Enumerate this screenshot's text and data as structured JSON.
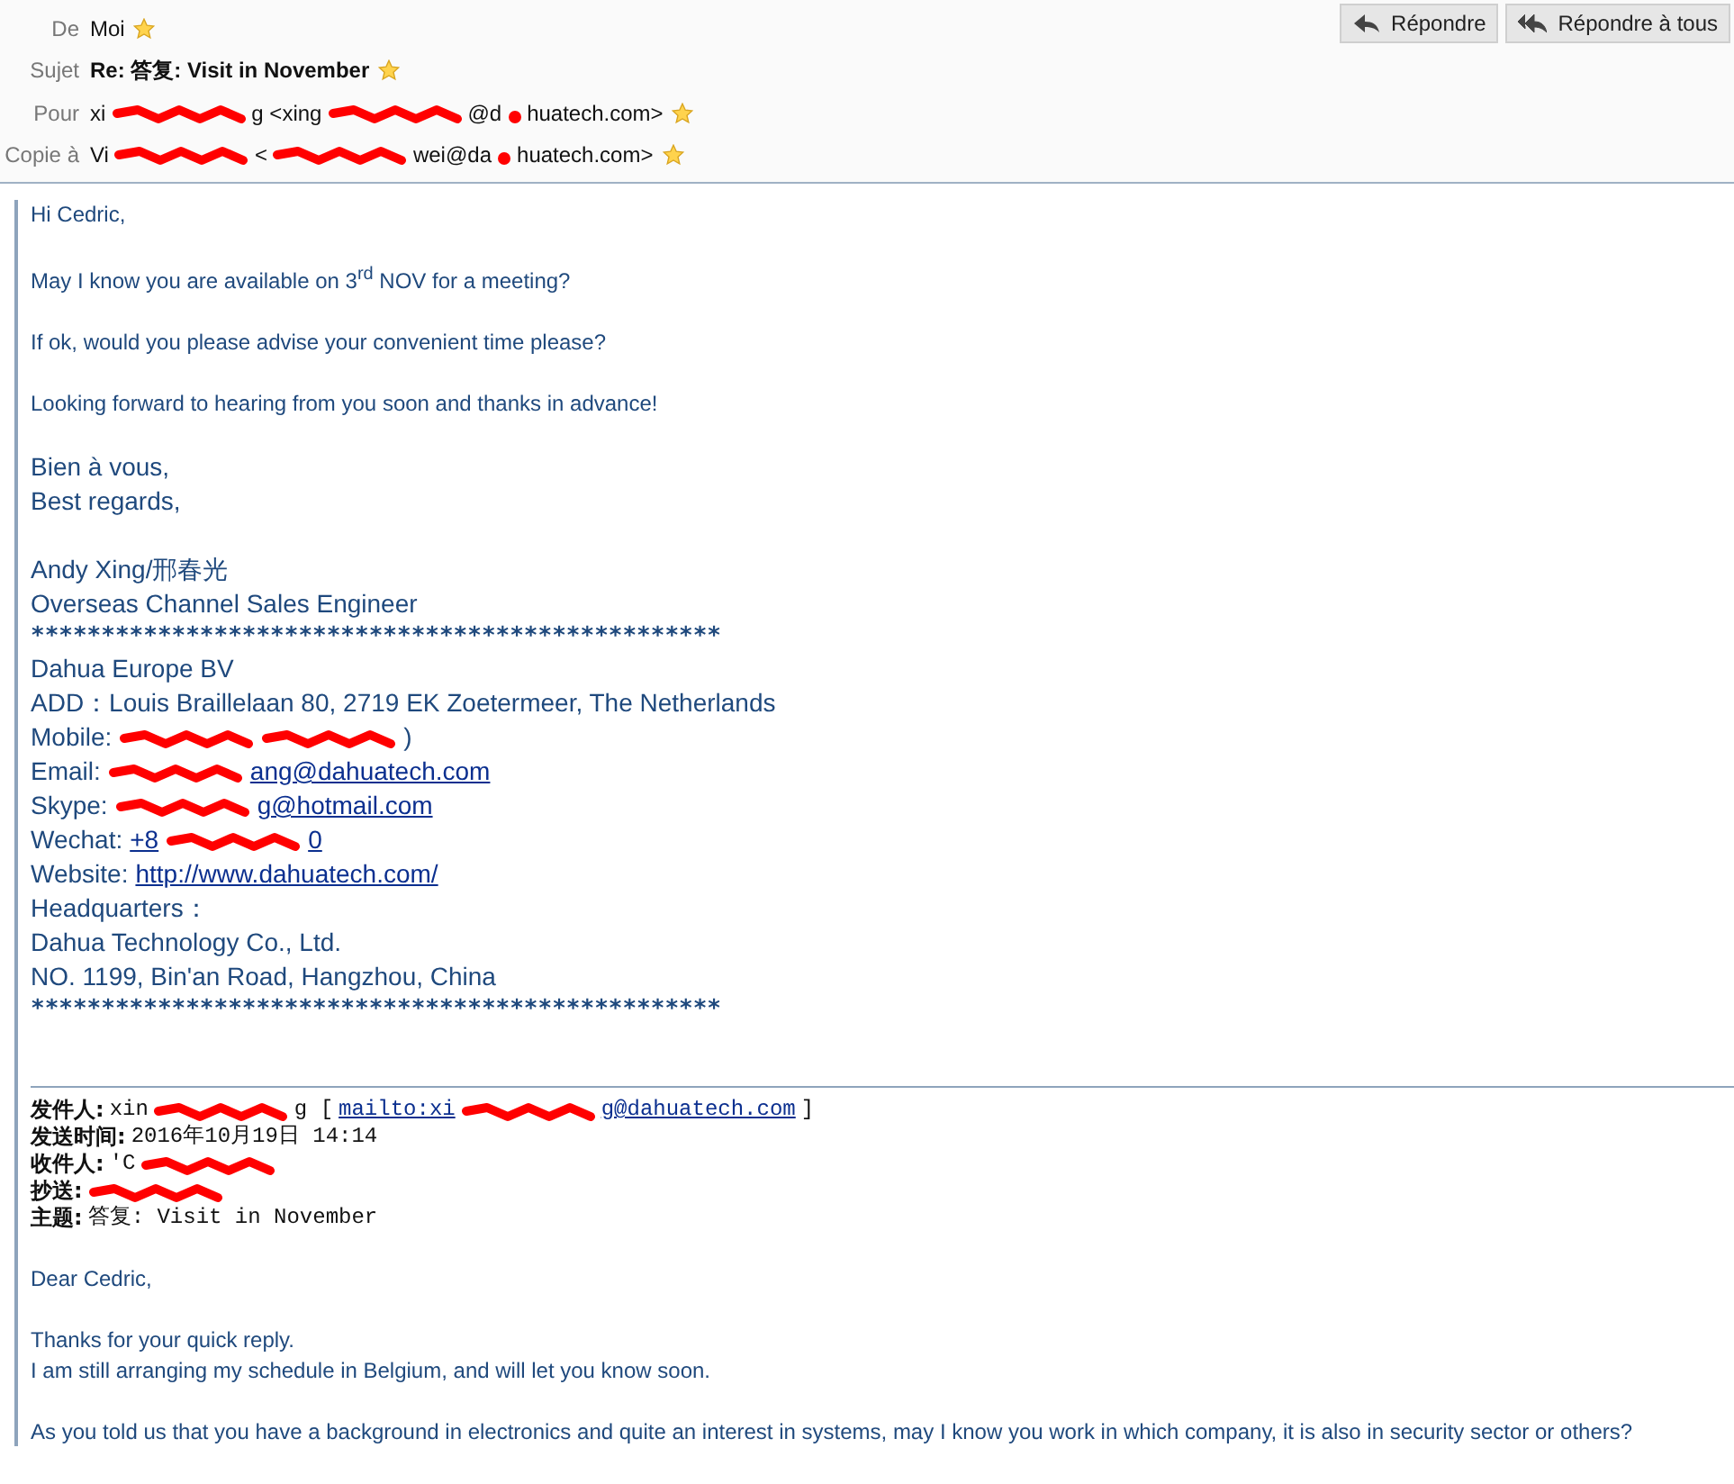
{
  "header": {
    "fields": [
      {
        "label": "De",
        "bold": false,
        "parts": [
          {
            "kind": "text",
            "text": "Moi"
          }
        ]
      },
      {
        "label": "Sujet",
        "bold": true,
        "parts": [
          {
            "kind": "text",
            "text": "Re: 答复: Visit in November"
          }
        ]
      },
      {
        "label": "Pour",
        "bold": false,
        "parts": [
          {
            "kind": "text",
            "text": "xi"
          },
          {
            "kind": "redaction"
          },
          {
            "kind": "text",
            "text": "g <xing"
          },
          {
            "kind": "redaction"
          },
          {
            "kind": "text",
            "text": "@d"
          },
          {
            "kind": "redaction-dot"
          },
          {
            "kind": "text",
            "text": "huatech.com>"
          }
        ]
      },
      {
        "label": "Copie à",
        "bold": false,
        "parts": [
          {
            "kind": "text",
            "text": "Vi"
          },
          {
            "kind": "redaction"
          },
          {
            "kind": "text",
            "text": "<"
          },
          {
            "kind": "redaction"
          },
          {
            "kind": "text",
            "text": "wei@da"
          },
          {
            "kind": "redaction-dot"
          },
          {
            "kind": "text",
            "text": "huatech.com>"
          }
        ]
      }
    ],
    "buttons": [
      "Répondre",
      "Répondre à tous"
    ]
  },
  "body": [
    {
      "kind": "small",
      "parts": [
        {
          "kind": "text",
          "text": "Hi Cedric,"
        }
      ]
    },
    {
      "kind": "small",
      "parts": [
        {
          "kind": "text",
          "text": "May I know you are available on 3$^{rd}$ NOV for a meeting?"
        }
      ]
    },
    {
      "kind": "small",
      "parts": [
        {
          "kind": "text",
          "text": "If ok, would you please advise your convenient time please?"
        }
      ]
    },
    {
      "kind": "small",
      "parts": [
        {
          "kind": "text",
          "text": "Looking forward to hearing from you soon and thanks in advance!"
        }
      ]
    },
    {
      "kind": "large",
      "parts": [
        {
          "kind": "text",
          "text": "Bien à vous,"
        }
      ]
    },
    {
      "kind": "large",
      "parts": [
        {
          "kind": "text",
          "text": "Best regards,"
        }
      ]
    },
    {
      "kind": "blank"
    },
    {
      "kind": "large",
      "parts": [
        {
          "kind": "text",
          "text": "Andy Xing/邢春光"
        }
      ]
    },
    {
      "kind": "large",
      "parts": [
        {
          "kind": "text",
          "text": "Overseas Channel Sales Engineer"
        }
      ]
    },
    {
      "kind": "stars",
      "text": "*************************************************"
    },
    {
      "kind": "large",
      "parts": [
        {
          "kind": "text",
          "text": "Dahua Europe BV"
        }
      ]
    },
    {
      "kind": "large",
      "parts": [
        {
          "kind": "text",
          "text": "ADD：Louis Braillelaan 80, 2719 EK Zoetermeer, The Netherlands"
        }
      ]
    },
    {
      "kind": "large",
      "parts": [
        {
          "kind": "text",
          "text": "Mobile:"
        },
        {
          "kind": "redaction"
        },
        {
          "kind": "redaction"
        },
        {
          "kind": "text",
          "text": ")"
        }
      ]
    },
    {
      "kind": "large",
      "parts": [
        {
          "kind": "text",
          "text": "Email:"
        },
        {
          "kind": "redaction"
        },
        {
          "kind": "link",
          "text": "ang@dahuatech.com"
        }
      ]
    },
    {
      "kind": "large",
      "parts": [
        {
          "kind": "text",
          "text": "Skype:"
        },
        {
          "kind": "redaction"
        },
        {
          "kind": "link",
          "text": "g@hotmail.com"
        }
      ]
    },
    {
      "kind": "large",
      "parts": [
        {
          "kind": "text",
          "text": "Wechat:"
        },
        {
          "kind": "link",
          "text": "+8"
        },
        {
          "kind": "redaction"
        },
        {
          "kind": "link",
          "text": "0"
        }
      ]
    },
    {
      "kind": "large",
      "parts": [
        {
          "kind": "text",
          "text": "Website:"
        },
        {
          "kind": "link",
          "text": "http://www.dahuatech.com/"
        }
      ]
    },
    {
      "kind": "large",
      "parts": [
        {
          "kind": "text",
          "text": "Headquarters："
        }
      ]
    },
    {
      "kind": "large",
      "parts": [
        {
          "kind": "text",
          "text": "Dahua Technology Co., Ltd."
        }
      ]
    },
    {
      "kind": "large",
      "parts": [
        {
          "kind": "text",
          "text": "NO. 1199, Bin'an Road, Hangzhou, China"
        }
      ]
    },
    {
      "kind": "stars",
      "text": "*************************************************"
    }
  ],
  "quoted": {
    "headers": [
      {
        "parts": [
          {
            "kind": "label",
            "text": "发件人:"
          },
          {
            "kind": "text",
            "text": "xin"
          },
          {
            "kind": "redaction"
          },
          {
            "kind": "text",
            "text": "g ["
          },
          {
            "kind": "link",
            "text": "mailto:xi"
          },
          {
            "kind": "redaction"
          },
          {
            "kind": "link",
            "text": "g@dahuatech.com"
          },
          {
            "kind": "text",
            "text": "]"
          }
        ]
      },
      {
        "parts": [
          {
            "kind": "label",
            "text": "发送时间:"
          },
          {
            "kind": "text",
            "text": "2016年10月19日 14:14"
          }
        ]
      },
      {
        "parts": [
          {
            "kind": "label",
            "text": "收件人:"
          },
          {
            "kind": "text",
            "text": "'C"
          },
          {
            "kind": "redaction"
          }
        ]
      },
      {
        "parts": [
          {
            "kind": "label",
            "text": "抄送:"
          },
          {
            "kind": "redaction"
          }
        ]
      },
      {
        "parts": [
          {
            "kind": "label",
            "text": "主题:"
          },
          {
            "kind": "text",
            "text": "答复: Visit in November"
          }
        ]
      }
    ],
    "body": [
      {
        "kind": "small",
        "parts": [
          {
            "kind": "text",
            "text": "Dear Cedric,"
          }
        ]
      },
      {
        "kind": "tight",
        "parts": [
          {
            "kind": "text",
            "text": "Thanks for your quick reply."
          }
        ]
      },
      {
        "kind": "small",
        "parts": [
          {
            "kind": "text",
            "text": "I am still arranging my schedule in Belgium, and will let you know soon."
          }
        ]
      },
      {
        "kind": "small",
        "parts": [
          {
            "kind": "text",
            "text": "As you told us that you have a background in electronics and quite an interest in systems, may I know you work in which company, it is also in security sector or others?"
          }
        ]
      }
    ]
  }
}
